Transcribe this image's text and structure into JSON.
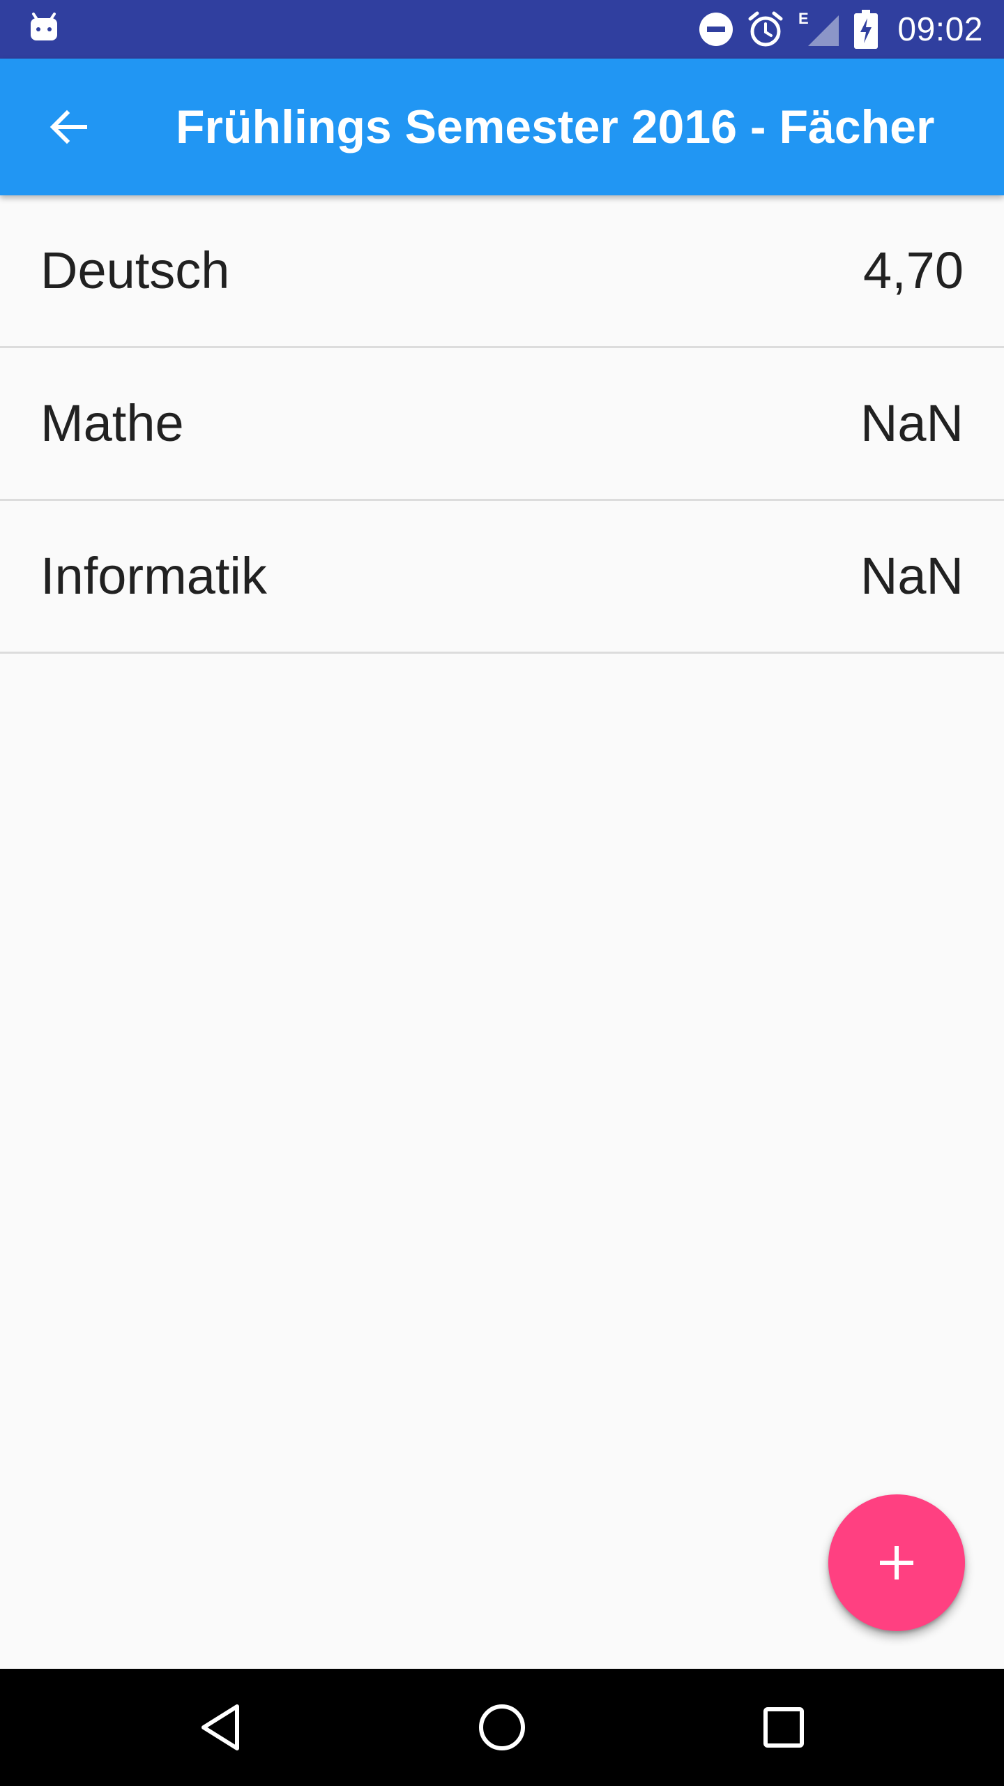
{
  "status_bar": {
    "time": "09:02",
    "network_type": "E",
    "icons": [
      "android-debug-icon",
      "do-not-disturb-icon",
      "alarm-icon",
      "signal-icon",
      "battery-charging-icon"
    ]
  },
  "app_bar": {
    "back_icon": "arrow-back-icon",
    "title": "Frühlings Semester 2016 - Fächer"
  },
  "subjects": [
    {
      "name": "Deutsch",
      "grade": "4,70"
    },
    {
      "name": "Mathe",
      "grade": "NaN"
    },
    {
      "name": "Informatik",
      "grade": "NaN"
    }
  ],
  "fab": {
    "icon": "add-icon"
  },
  "nav_bar": {
    "icons": [
      "nav-back-icon",
      "nav-home-icon",
      "nav-recents-icon"
    ]
  },
  "colors": {
    "status_bar": "#303f9f",
    "primary": "#2196f3",
    "accent": "#ff4081",
    "background": "#fafafa",
    "divider": "#dcdcdc",
    "text": "#212121"
  }
}
